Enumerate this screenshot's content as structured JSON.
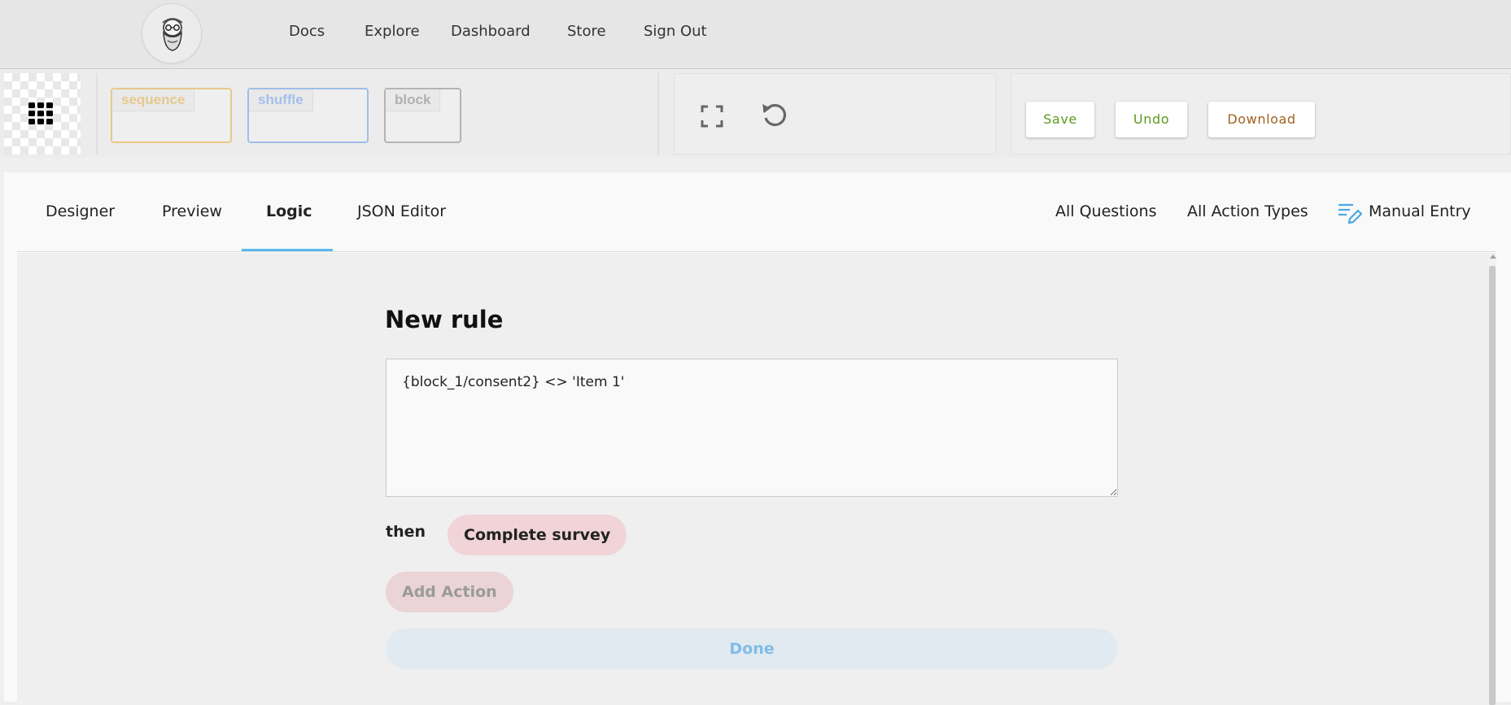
{
  "nav": {
    "links": [
      "Docs",
      "Explore",
      "Dashboard",
      "Store",
      "Sign Out"
    ]
  },
  "toolbar": {
    "blocks": [
      {
        "label": "sequence",
        "color": "#e8c98a"
      },
      {
        "label": "shuffle",
        "color": "#9fbde8"
      },
      {
        "label": "block",
        "color": "#b4b4b4"
      }
    ],
    "icons": [
      "grid-icon",
      "fullscreen-icon",
      "reset-icon"
    ],
    "buttons": {
      "save": {
        "label": "Save",
        "color": "#5a9a1e"
      },
      "undo": {
        "label": "Undo",
        "color": "#5a9a1e"
      },
      "download": {
        "label": "Download",
        "color": "#a0621e"
      }
    }
  },
  "tabs": {
    "items": [
      "Designer",
      "Preview",
      "Logic",
      "JSON Editor"
    ],
    "active": "Logic"
  },
  "right_tools": {
    "all_questions": "All Questions",
    "all_action_types": "All Action Types",
    "manual_entry": "Manual Entry"
  },
  "rule": {
    "title": "New rule",
    "expression": "{block_1/consent2} <> 'Item 1'",
    "then_label": "then",
    "action": "Complete survey",
    "add_action": "Add Action",
    "done": "Done"
  },
  "colors": {
    "accent": "#5bb8ee",
    "action_pill": "#f0d4d8",
    "done_bg": "#e1eaf1"
  }
}
